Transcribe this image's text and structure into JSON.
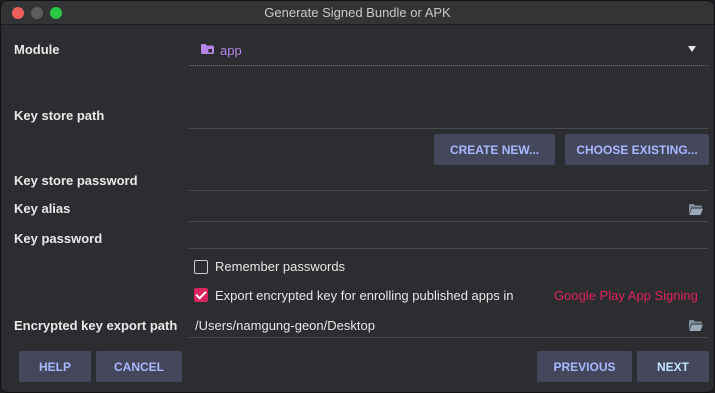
{
  "window": {
    "title": "Generate Signed Bundle or APK"
  },
  "labels": {
    "module": "Module",
    "key_store_path": "Key store path",
    "key_store_password": "Key store password",
    "key_alias": "Key alias",
    "key_password": "Key password",
    "export_path": "Encrypted key export path"
  },
  "module": {
    "value": "app",
    "icon": "folder-icon"
  },
  "buttons": {
    "create_new": "CREATE NEW...",
    "choose_existing": "CHOOSE EXISTING...",
    "help": "HELP",
    "cancel": "CANCEL",
    "previous": "PREVIOUS",
    "next": "NEXT"
  },
  "options": {
    "remember_passwords": {
      "label": "Remember passwords",
      "checked": false
    },
    "export_encrypted_key": {
      "label": "Export encrypted key for enrolling published apps in",
      "link": "Google Play App Signing",
      "checked": true
    }
  },
  "fields": {
    "key_store_path": "",
    "key_store_password": "",
    "key_alias": "",
    "key_password": "",
    "export_path": "/Users/namgung-geon/Desktop"
  },
  "colors": {
    "accent": "#d6245c",
    "button_text": "#a9b8ff",
    "button_bg": "#44475c",
    "module_text": "#b685e8"
  }
}
